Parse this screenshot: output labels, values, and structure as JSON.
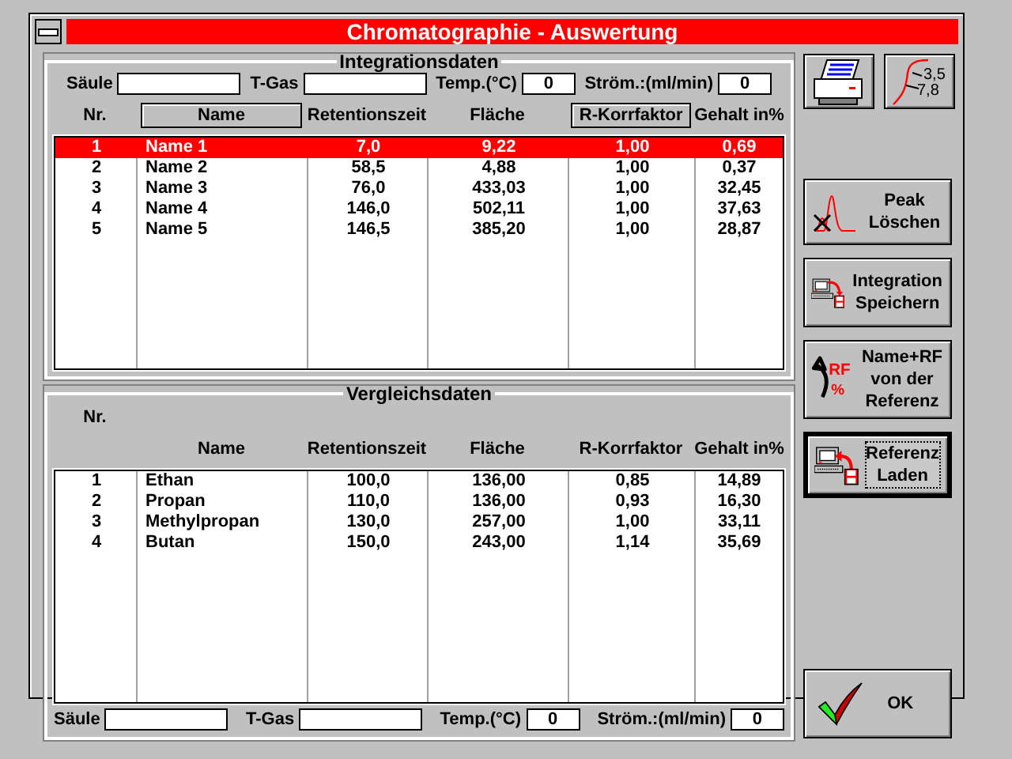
{
  "window": {
    "title": "Chromatographie - Auswertung"
  },
  "integration": {
    "title": "Integrationsdaten",
    "fields": [
      {
        "label": "Säule",
        "kind": "text"
      },
      {
        "label": "T-Gas",
        "kind": "text"
      },
      {
        "label": "Temp.(°C)",
        "kind": "number",
        "value": "0"
      },
      {
        "label": "Ström.:(ml/min)",
        "kind": "number",
        "value": "0"
      }
    ],
    "columns": [
      {
        "label": "Nr.",
        "kind": "label"
      },
      {
        "label": "Name",
        "kind": "button"
      },
      {
        "label": "Retentionszeit",
        "kind": "label"
      },
      {
        "label": "Fläche",
        "kind": "label"
      },
      {
        "label": "R-Korrfaktor",
        "kind": "button"
      },
      {
        "label": "Gehalt in%",
        "kind": "label"
      }
    ],
    "rows": [
      {
        "cells": [
          "1",
          "Name 1",
          "7,0",
          "9,22",
          "1,00",
          "0,69"
        ],
        "selected": true
      },
      {
        "cells": [
          "2",
          "Name 2",
          "58,5",
          "4,88",
          "1,00",
          "0,37"
        ],
        "selected": false
      },
      {
        "cells": [
          "3",
          "Name 3",
          "76,0",
          "433,03",
          "1,00",
          "32,45"
        ],
        "selected": false
      },
      {
        "cells": [
          "4",
          "Name 4",
          "146,0",
          "502,11",
          "1,00",
          "37,63"
        ],
        "selected": false
      },
      {
        "cells": [
          "5",
          "Name 5",
          "146,5",
          "385,20",
          "1,00",
          "28,87"
        ],
        "selected": false
      }
    ]
  },
  "reference": {
    "title": "Vergleichsdaten",
    "columns": [
      {
        "label": "Nr.",
        "kind": "label"
      },
      {
        "label": "Name",
        "kind": "label"
      },
      {
        "label": "Retentionszeit",
        "kind": "label"
      },
      {
        "label": "Fläche",
        "kind": "label"
      },
      {
        "label": "R-Korrfaktor",
        "kind": "label"
      },
      {
        "label": "Gehalt in%",
        "kind": "label"
      }
    ],
    "rows": [
      {
        "cells": [
          "1",
          "Ethan",
          "100,0",
          "136,00",
          "0,85",
          "14,89"
        ],
        "selected": false
      },
      {
        "cells": [
          "2",
          "Propan",
          "110,0",
          "136,00",
          "0,93",
          "16,30"
        ],
        "selected": false
      },
      {
        "cells": [
          "3",
          "Methylpropan",
          "130,0",
          "257,00",
          "1,00",
          "33,11"
        ],
        "selected": false
      },
      {
        "cells": [
          "4",
          "Butan",
          "150,0",
          "243,00",
          "1,14",
          "35,69"
        ],
        "selected": false
      }
    ],
    "fields": [
      {
        "label": "Säule",
        "kind": "text"
      },
      {
        "label": "T-Gas",
        "kind": "text"
      },
      {
        "label": "Temp.(°C)",
        "kind": "number",
        "value": "0"
      },
      {
        "label": "Ström.:(ml/min)",
        "kind": "number",
        "value": "0"
      }
    ]
  },
  "toolbar": [
    {
      "kind": "print"
    },
    {
      "kind": "peak-values",
      "icon_text": [
        "3,5",
        "7,8"
      ]
    }
  ],
  "buttons": [
    {
      "kind": "peak-delete",
      "label": "Peak\nLöschen",
      "focused": false
    },
    {
      "kind": "save",
      "label": "Integration\nSpeichern",
      "focused": false
    },
    {
      "kind": "reference-rf",
      "label": "Name+RF\nvon der\nReferenz",
      "icon_text": [
        "RF",
        "%"
      ],
      "focused": false
    },
    {
      "kind": "load",
      "label": "Referenz\nLaden",
      "focused": true
    },
    {
      "kind": "ok",
      "label": "OK",
      "focused": false
    }
  ]
}
